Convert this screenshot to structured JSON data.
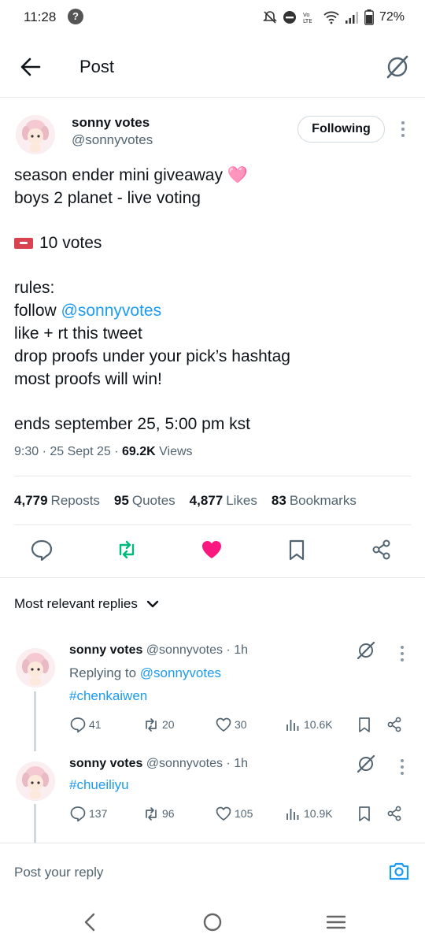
{
  "status_bar": {
    "time": "11:28",
    "battery": "72%"
  },
  "header": {
    "title": "Post"
  },
  "post": {
    "author_name": "sonny votes",
    "author_handle": "@sonnyvotes",
    "follow_label": "Following",
    "lines": {
      "l1": "season ender mini giveaway 🩷",
      "l2": "boys 2 planet - live voting",
      "l3": "10 votes",
      "l4": "rules:",
      "l5_prefix": "follow ",
      "l5_mention": "@sonnyvotes",
      "l6": "like + rt this tweet",
      "l7": "drop proofs under your pick’s hashtag",
      "l8": "most proofs will win!",
      "l9": "ends september 25, 5:00 pm kst"
    },
    "meta": {
      "time": "9:30 · 25 Sept 25 · ",
      "views_count": "69.2K",
      "views_label": " Views"
    },
    "stats": {
      "reposts_count": "4,779",
      "reposts_label": "Reposts",
      "quotes_count": "95",
      "quotes_label": "Quotes",
      "likes_count": "4,877",
      "likes_label": "Likes",
      "bookmarks_count": "83",
      "bookmarks_label": "Bookmarks"
    }
  },
  "replies_header": "Most relevant replies",
  "replies": [
    {
      "name": "sonny votes",
      "meta": " @sonnyvotes · 1h",
      "replying_prefix": "Replying to ",
      "replying_mention": "@sonnyvotes",
      "hashtag": "#chenkaiwen",
      "comments": "41",
      "reposts": "20",
      "likes": "30",
      "views": "10.6K"
    },
    {
      "name": "sonny votes",
      "meta": " @sonnyvotes · 1h",
      "hashtag": "#chueiliyu",
      "comments": "137",
      "reposts": "96",
      "likes": "105",
      "views": "10.9K"
    }
  ],
  "composer": {
    "placeholder": "Post your reply"
  },
  "colors": {
    "accent": "#1d9bf0",
    "like": "#f91880",
    "repost": "#00ba7c",
    "text": "#0f1419",
    "muted": "#536471"
  }
}
